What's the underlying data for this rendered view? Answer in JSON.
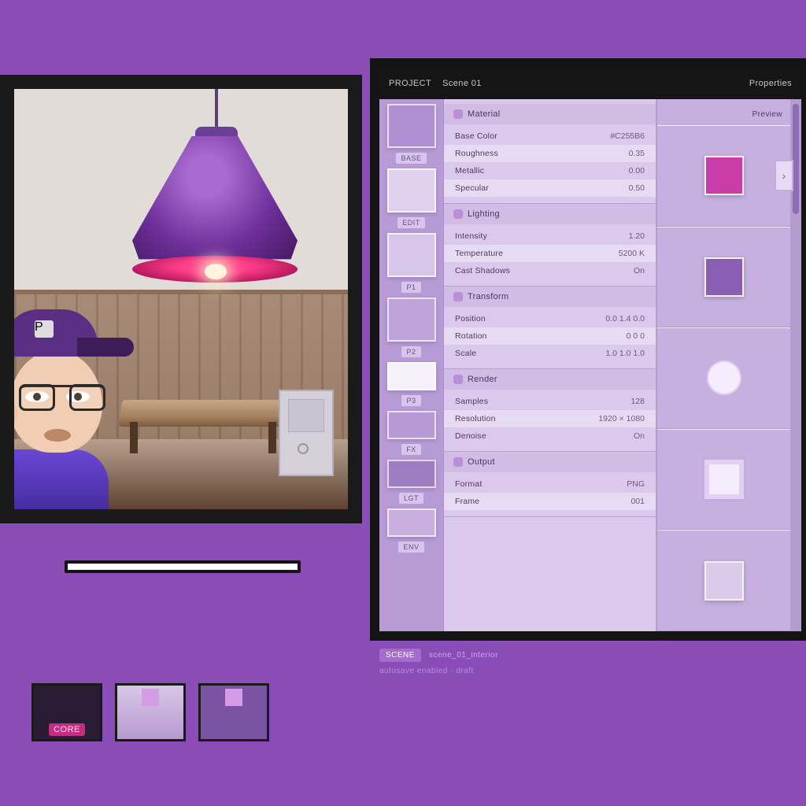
{
  "preview": {
    "cap_patch": "P",
    "thumbs": [
      {
        "badge": "CORE",
        "variant": "a"
      },
      {
        "badge": "",
        "variant": "b"
      },
      {
        "badge": "",
        "variant": "c"
      }
    ]
  },
  "props": {
    "titlebar": {
      "left": "PROJECT",
      "mid": "Scene 01",
      "right": "Properties"
    },
    "swatch_labels": [
      "BASE",
      "EDIT",
      "P1",
      "P2",
      "P3",
      "FX",
      "LGT",
      "ENV"
    ],
    "swatches": [
      "#b08fd0",
      "#dfd0ee",
      "#d8c5ea",
      "#c0a2db",
      "#f6f0fb",
      "#b998d6",
      "#a07cc2",
      "#c9afe0"
    ],
    "sections": [
      {
        "title": "Material",
        "rows": [
          {
            "label": "Base Color",
            "value": "#C255B6"
          },
          {
            "label": "Roughness",
            "value": "0.35"
          },
          {
            "label": "Metallic",
            "value": "0.00"
          },
          {
            "label": "Specular",
            "value": "0.50"
          }
        ]
      },
      {
        "title": "Lighting",
        "rows": [
          {
            "label": "Intensity",
            "value": "1.20"
          },
          {
            "label": "Temperature",
            "value": "5200 K"
          },
          {
            "label": "Cast Shadows",
            "value": "On"
          }
        ]
      },
      {
        "title": "Transform",
        "rows": [
          {
            "label": "Position",
            "value": "0.0  1.4  0.0"
          },
          {
            "label": "Rotation",
            "value": "0   0   0"
          },
          {
            "label": "Scale",
            "value": "1.0 1.0 1.0"
          }
        ]
      },
      {
        "title": "Render",
        "rows": [
          {
            "label": "Samples",
            "value": "128"
          },
          {
            "label": "Resolution",
            "value": "1920 × 1080"
          },
          {
            "label": "Denoise",
            "value": "On"
          }
        ]
      },
      {
        "title": "Output",
        "rows": [
          {
            "label": "Format",
            "value": "PNG"
          },
          {
            "label": "Frame",
            "value": "001"
          }
        ]
      }
    ],
    "preview_col": {
      "header": "Preview",
      "chips": [
        "#c83da8",
        "#8a5fb3",
        "#d9cbe9"
      ]
    }
  },
  "footer": {
    "tag": "SCENE",
    "line1": "scene_01_interior",
    "line2": "autosave enabled · draft"
  },
  "colors": {
    "accent": "#c83da8",
    "violet": "#8a4db8"
  }
}
